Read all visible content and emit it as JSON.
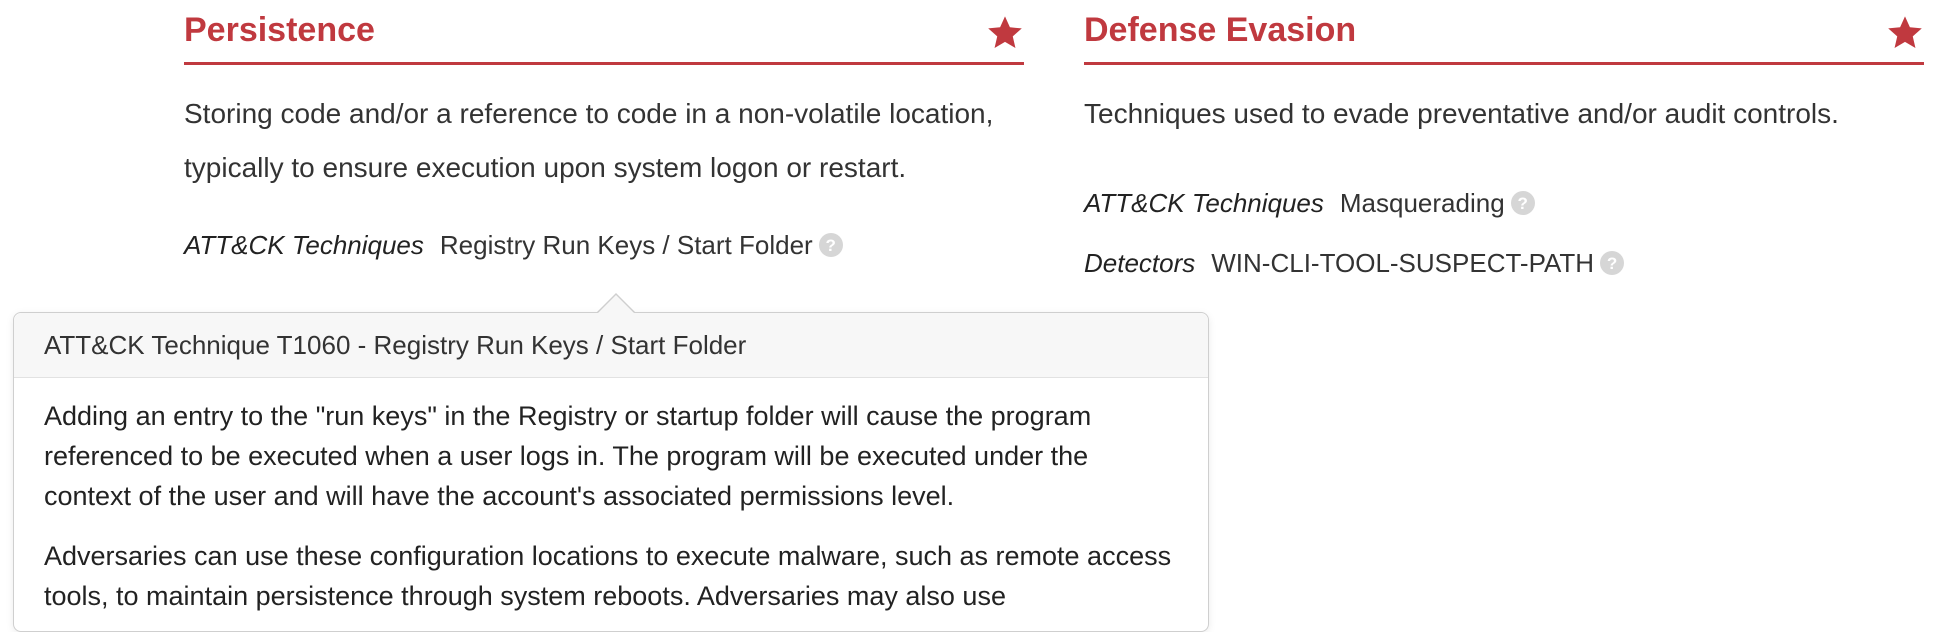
{
  "cards": [
    {
      "title": "Persistence",
      "description": "Storing code and/or a reference to code in a non-volatile location, typically to ensure execution upon system logon or restart.",
      "techniques_label": "ATT&CK Techniques",
      "techniques_value": "Registry Run Keys / Start Folder"
    },
    {
      "title": "Defense Evasion",
      "description": "Techniques used to evade preventative and/or audit controls.",
      "techniques_label": "ATT&CK Techniques",
      "techniques_value": "Masquerading",
      "detectors_label": "Detectors",
      "detectors_value": "WIN-CLI-TOOL-SUSPECT-PATH"
    }
  ],
  "popover": {
    "title": "ATT&CK Technique T1060 - Registry Run Keys / Start Folder",
    "paragraphs": [
      "Adding an entry to the \"run keys\" in the Registry or startup folder will cause the program referenced to be executed when a user logs in. The program will be executed under the context of the user and will have the account's associated permissions level.",
      "Adversaries can use these configuration locations to execute malware, such as remote access tools, to maintain persistence through system reboots. Adversaries may also use"
    ]
  },
  "icons": {
    "favorite": "star-icon",
    "help": "question-circle-icon"
  },
  "colors": {
    "accent": "#c0393f",
    "help_icon": "#d6d6d6",
    "popover_header_bg": "#f7f7f7"
  }
}
